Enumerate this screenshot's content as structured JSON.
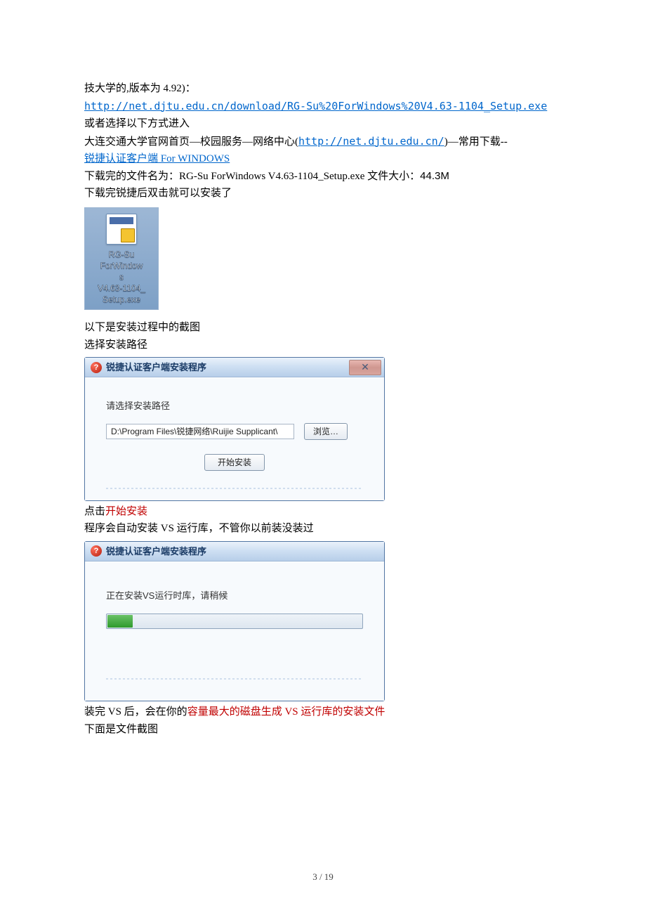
{
  "body": {
    "line1": "技大学的,版本为 4.92)：",
    "url1_text": "http://net.djtu.edu.cn/download/RG-Su%20ForWindows%20V4.63-1104_Setup.exe",
    "line2": "或者选择以下方式进入",
    "line3_prefix": "大连交通大学官网首页—校园服务—网络中心(",
    "url2_text": "http://net.djtu.edu.cn/",
    "line3_suffix": ")—常用下载--",
    "url3_text": "锐捷认证客户端 For WINDOWS",
    "line4_a": "下载完的文件名为：RG-Su ForWindows V4.63-1104_Setup.exe 文件大小：",
    "line4_b": "44.3M",
    "line5": "下载完锐捷后双击就可以安装了",
    "line6": "以下是安装过程中的截图",
    "line7": "选择安装路径",
    "line8_a": "点击",
    "line8_b": "开始安装",
    "line9": "程序会自动安装 VS 运行库，不管你以前装没装过",
    "line10_a": "装完 VS 后，会在你的",
    "line10_b": "容量最大的磁盘生成 VS 运行库的安装文件",
    "line11": "下面是文件截图"
  },
  "desktop_icon": {
    "l1": "RG-Su",
    "l2": "ForWindow",
    "l3": "s",
    "l4": "V4.63-1104_",
    "l5": "Setup.exe"
  },
  "dialog1": {
    "title": "锐捷认证客户端安装程序",
    "close_char": "✕",
    "prompt": "请选择安装路径",
    "path_value": "D:\\Program Files\\锐捷网络\\Ruijie Supplicant\\",
    "browse": "浏览…",
    "start": "开始安装"
  },
  "dialog2": {
    "title": "锐捷认证客户端安装程序",
    "status": "正在安装VS运行时库，请稍候"
  },
  "footer": "3  /  19"
}
